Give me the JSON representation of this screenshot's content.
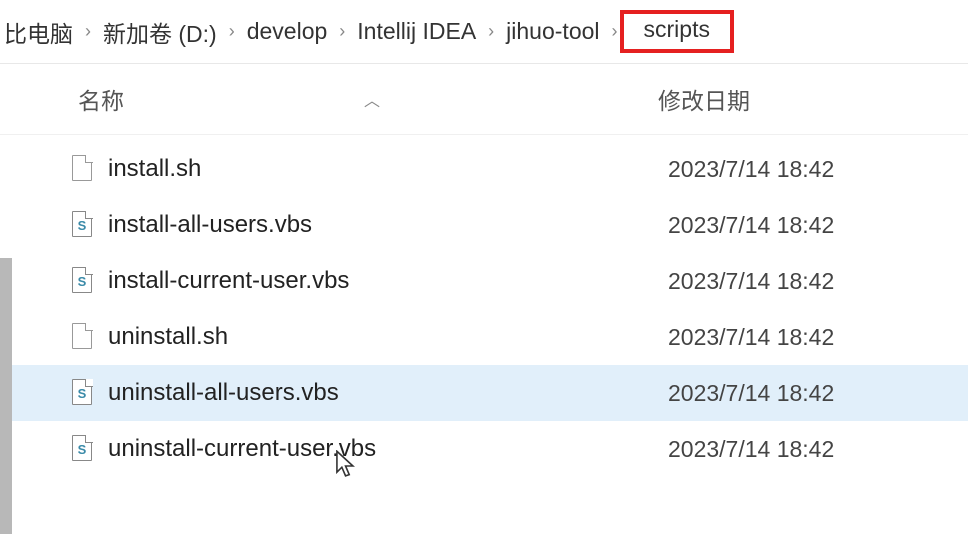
{
  "breadcrumb": {
    "items": [
      "比电脑",
      "新加卷 (D:)",
      "develop",
      "Intellij IDEA",
      "jihuo-tool",
      "scripts"
    ],
    "highlight_index": 5
  },
  "columns": {
    "name_label": "名称",
    "date_label": "修改日期"
  },
  "files": [
    {
      "name": "install.sh",
      "date": "2023/7/14 18:42",
      "icon": "generic",
      "selected": false
    },
    {
      "name": "install-all-users.vbs",
      "date": "2023/7/14 18:42",
      "icon": "vbs",
      "selected": false
    },
    {
      "name": "install-current-user.vbs",
      "date": "2023/7/14 18:42",
      "icon": "vbs",
      "selected": false
    },
    {
      "name": "uninstall.sh",
      "date": "2023/7/14 18:42",
      "icon": "generic",
      "selected": false
    },
    {
      "name": "uninstall-all-users.vbs",
      "date": "2023/7/14 18:42",
      "icon": "vbs",
      "selected": true
    },
    {
      "name": "uninstall-current-user.vbs",
      "date": "2023/7/14 18:42",
      "icon": "vbs",
      "selected": false
    }
  ]
}
